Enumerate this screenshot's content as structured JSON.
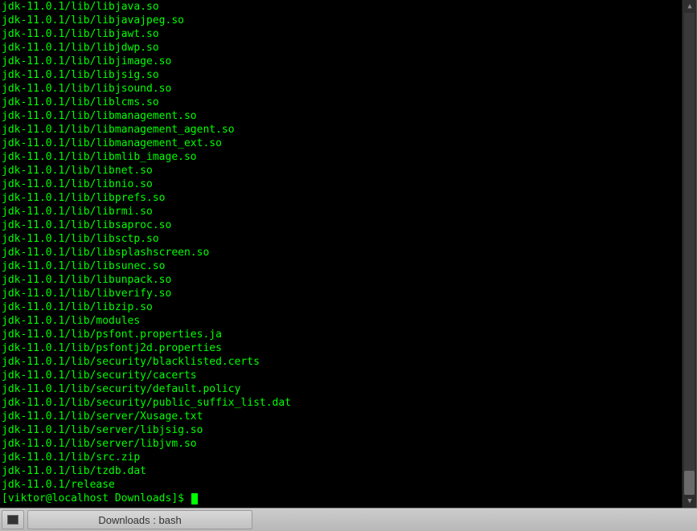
{
  "terminal": {
    "output_lines": [
      "jdk-11.0.1/lib/libjava.so",
      "jdk-11.0.1/lib/libjavajpeg.so",
      "jdk-11.0.1/lib/libjawt.so",
      "jdk-11.0.1/lib/libjdwp.so",
      "jdk-11.0.1/lib/libjimage.so",
      "jdk-11.0.1/lib/libjsig.so",
      "jdk-11.0.1/lib/libjsound.so",
      "jdk-11.0.1/lib/liblcms.so",
      "jdk-11.0.1/lib/libmanagement.so",
      "jdk-11.0.1/lib/libmanagement_agent.so",
      "jdk-11.0.1/lib/libmanagement_ext.so",
      "jdk-11.0.1/lib/libmlib_image.so",
      "jdk-11.0.1/lib/libnet.so",
      "jdk-11.0.1/lib/libnio.so",
      "jdk-11.0.1/lib/libprefs.so",
      "jdk-11.0.1/lib/librmi.so",
      "jdk-11.0.1/lib/libsaproc.so",
      "jdk-11.0.1/lib/libsctp.so",
      "jdk-11.0.1/lib/libsplashscreen.so",
      "jdk-11.0.1/lib/libsunec.so",
      "jdk-11.0.1/lib/libunpack.so",
      "jdk-11.0.1/lib/libverify.so",
      "jdk-11.0.1/lib/libzip.so",
      "jdk-11.0.1/lib/modules",
      "jdk-11.0.1/lib/psfont.properties.ja",
      "jdk-11.0.1/lib/psfontj2d.properties",
      "jdk-11.0.1/lib/security/blacklisted.certs",
      "jdk-11.0.1/lib/security/cacerts",
      "jdk-11.0.1/lib/security/default.policy",
      "jdk-11.0.1/lib/security/public_suffix_list.dat",
      "jdk-11.0.1/lib/server/Xusage.txt",
      "jdk-11.0.1/lib/server/libjsig.so",
      "jdk-11.0.1/lib/server/libjvm.so",
      "jdk-11.0.1/lib/src.zip",
      "jdk-11.0.1/lib/tzdb.dat",
      "jdk-11.0.1/release"
    ],
    "prompt": "[viktor@localhost Downloads]$ "
  },
  "taskbar": {
    "app_title": "Downloads : bash"
  }
}
